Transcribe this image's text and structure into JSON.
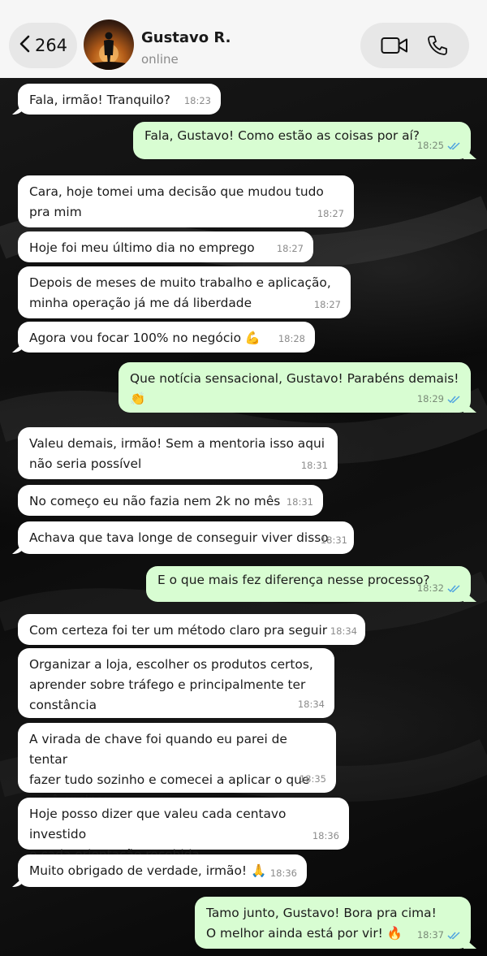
{
  "header": {
    "back_count": "264",
    "contact_name": "Gustavo R.",
    "contact_status": "online"
  },
  "messages": [
    {
      "dir": "in",
      "text": "Fala, irmão! Tranquilo?",
      "time": "18:23"
    },
    {
      "dir": "out",
      "text": "Fala, Gustavo! Como estão as coisas por aí?",
      "time": "18:25"
    },
    {
      "dir": "in",
      "text": "Cara, hoje tomei uma decisão que mudou tudo\npra mim",
      "time": "18:27"
    },
    {
      "dir": "in",
      "text": "Hoje foi meu último dia no emprego",
      "time": "18:27"
    },
    {
      "dir": "in",
      "text": "Depois de meses de muito trabalho e aplicação,\nminha operação já me dá liberdade",
      "time": "18:27"
    },
    {
      "dir": "in",
      "text": "Agora vou focar 100% no negócio 💪",
      "time": "18:28"
    },
    {
      "dir": "out",
      "text": "Que notícia sensacional, Gustavo! Parabéns demais!\n👏",
      "time": "18:29"
    },
    {
      "dir": "in",
      "text": "Valeu demais, irmão! Sem a mentoria isso aqui\nnão seria possível",
      "time": "18:31"
    },
    {
      "dir": "in",
      "text": "No começo eu não fazia nem 2k no mês",
      "time": "18:31"
    },
    {
      "dir": "in",
      "text": "Achava que tava longe de conseguir viver disso",
      "time": "18:31"
    },
    {
      "dir": "out",
      "text": "E o que mais fez diferença nesse processo?",
      "time": "18:32"
    },
    {
      "dir": "in",
      "text": "Com certeza foi ter um método claro pra seguir",
      "time": "18:34"
    },
    {
      "dir": "in",
      "text": "Organizar a loja, escolher os produtos certos,\naprender sobre tráfego e principalmente ter\nconstância",
      "time": "18:34"
    },
    {
      "dir": "in",
      "text": "A virada de chave foi quando eu parei de tentar\nfazer tudo sozinho e comecei a aplicar o que\nvocê ensinou",
      "time": "18:35"
    },
    {
      "dir": "in",
      "text": "Hoje posso dizer que valeu cada centavo investido\ne cada orientação recebida",
      "time": "18:36"
    },
    {
      "dir": "in",
      "text": "Muito obrigado de verdade, irmão! 🙏",
      "time": "18:36"
    },
    {
      "dir": "out",
      "text": "Tamo junto, Gustavo! Bora pra cima!\nO melhor ainda está por vir! 🔥",
      "time": "18:37"
    }
  ],
  "icons": {
    "back": "chevron-left-icon",
    "video": "video-camera-icon",
    "phone": "phone-icon",
    "read_receipt": "double-check-icon"
  },
  "colors": {
    "outgoing_bubble": "#d8fdd2",
    "incoming_bubble": "#ffffff",
    "read_tick": "#4fa3e0",
    "header_bg": "#f6f6f6"
  }
}
